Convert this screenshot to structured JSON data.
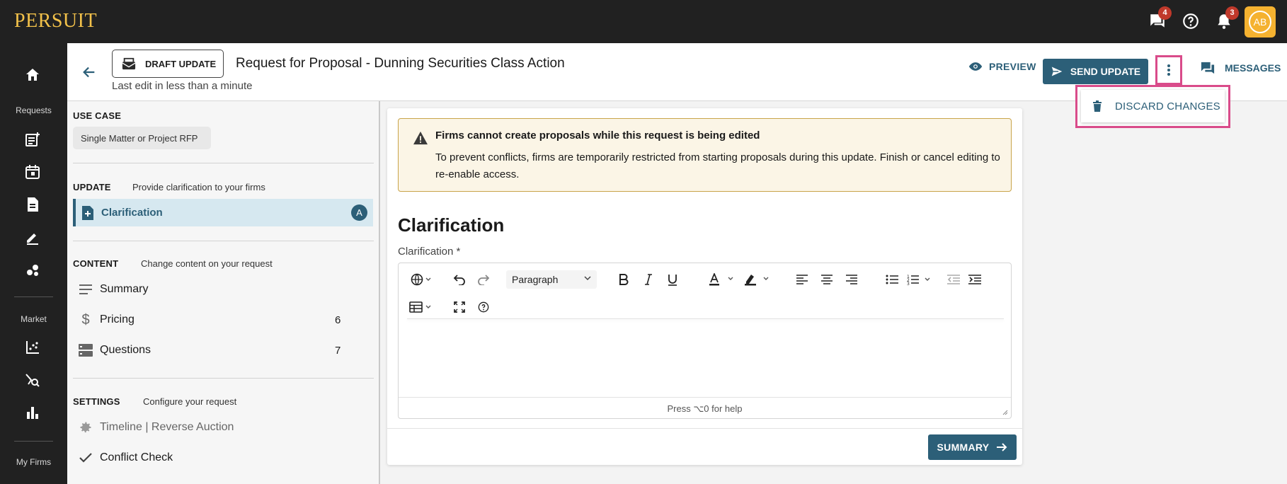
{
  "brand": {
    "logo_text": "PERSUIT"
  },
  "topbar": {
    "chat_badge": "4",
    "notification_badge": "3",
    "avatar_initials": "AB"
  },
  "leftnav": {
    "requests_label": "Requests",
    "market_label": "Market",
    "myfirms_label": "My Firms"
  },
  "header": {
    "draft_chip_label": "DRAFT UPDATE",
    "title": "Request for Proposal - Dunning Securities Class Action",
    "last_edit": "Last edit in less than a minute",
    "preview_label": "PREVIEW",
    "send_update_label": "SEND UPDATE",
    "messages_label": "MESSAGES"
  },
  "menu": {
    "discard_label": "DISCARD CHANGES"
  },
  "sidebar": {
    "use_case_heading": "USE CASE",
    "use_case_value": "Single Matter or Project RFP",
    "update_heading": "UPDATE",
    "update_sub": "Provide clarification to your firms",
    "clarification_label": "Clarification",
    "clarification_badge": "A",
    "content_heading": "CONTENT",
    "content_sub": "Change content on your request",
    "content_items": [
      {
        "label": "Summary",
        "count": ""
      },
      {
        "label": "Pricing",
        "count": "6"
      },
      {
        "label": "Questions",
        "count": "7"
      }
    ],
    "settings_heading": "SETTINGS",
    "settings_sub": "Configure your request",
    "settings_items": [
      {
        "label": "Timeline | Reverse Auction"
      },
      {
        "label": "Conflict Check"
      }
    ]
  },
  "main": {
    "warning_title": "Firms cannot create proposals while this request is being edited",
    "warning_body": "To prevent conflicts, firms are temporarily restricted from starting proposals during this update. Finish or cancel editing to re-enable access.",
    "section_title": "Clarification",
    "field_label": "Clarification *",
    "paragraph_select": "Paragraph",
    "help_text": "Press ⌥0 for help",
    "summary_button": "SUMMARY"
  },
  "colors": {
    "topbar_bg": "#212121",
    "logo": "#f2c14a",
    "accent": "#2c5f78",
    "highlight": "#d94b8a",
    "avatar": "#f5b230",
    "badge": "#c0392b",
    "warning_bg": "#fbf5e6"
  }
}
